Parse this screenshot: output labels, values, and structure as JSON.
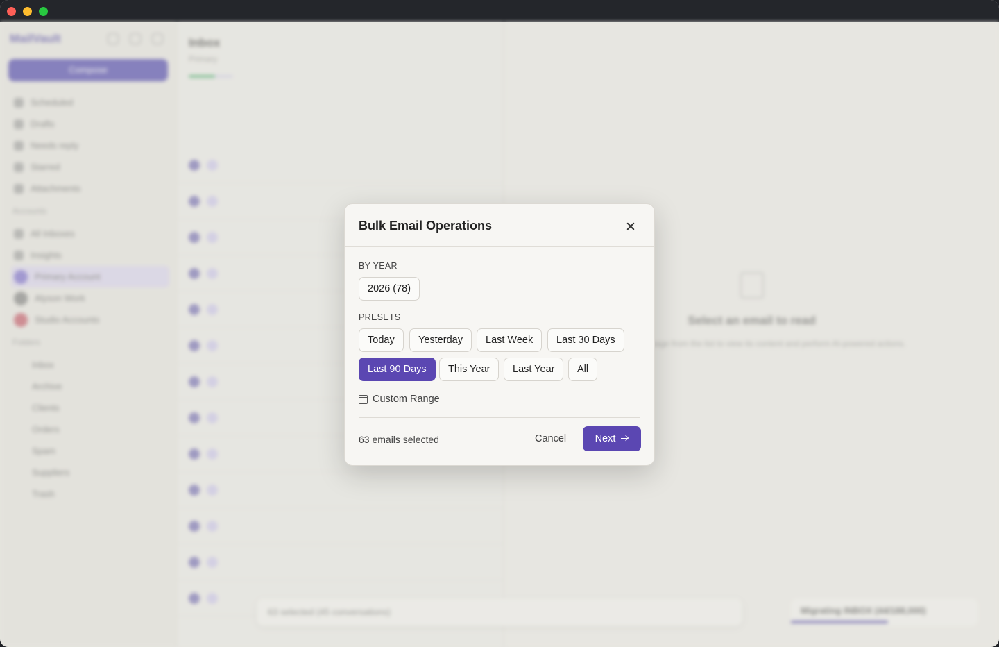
{
  "background": {
    "app_name": "MailVault",
    "compose_label": "Compose",
    "sidebar_items": [
      "Scheduled",
      "Drafts",
      "Needs reply",
      "Starred",
      "Attachments"
    ],
    "accounts_label": "Accounts",
    "accounts": [
      "All Inboxes",
      "Insights",
      "Primary Account",
      "Alyson Work",
      "Studio Accounts"
    ],
    "folders_label": "Folders",
    "folder_items": [
      "Inbox",
      "Archive",
      "Clients",
      "Orders",
      "Spam",
      "Suppliers",
      "Trash"
    ],
    "list_title": "Inbox",
    "list_subtitle": "Primary",
    "reader_title": "Select an email to read",
    "reader_desc": "Choose a message from the list to view its content and perform AI-powered actions.",
    "bulk_bar_text": "63 selected (45 conversations)",
    "sync_text": "Migrating INBOX (44/188,000)"
  },
  "modal": {
    "title": "Bulk Email Operations",
    "by_year_label": "BY YEAR",
    "year_chip": "2026 (78)",
    "presets_label": "PRESETS",
    "presets": [
      "Today",
      "Yesterday",
      "Last Week",
      "Last 30 Days",
      "Last 90 Days",
      "This Year",
      "Last Year",
      "All"
    ],
    "selected_preset": "Last 90 Days",
    "custom_range_label": "Custom Range",
    "selected_count": "63 emails selected",
    "cancel_label": "Cancel",
    "next_label": "Next"
  },
  "colors": {
    "accent": "#5b47b2",
    "overlay": "#e1dfda"
  }
}
